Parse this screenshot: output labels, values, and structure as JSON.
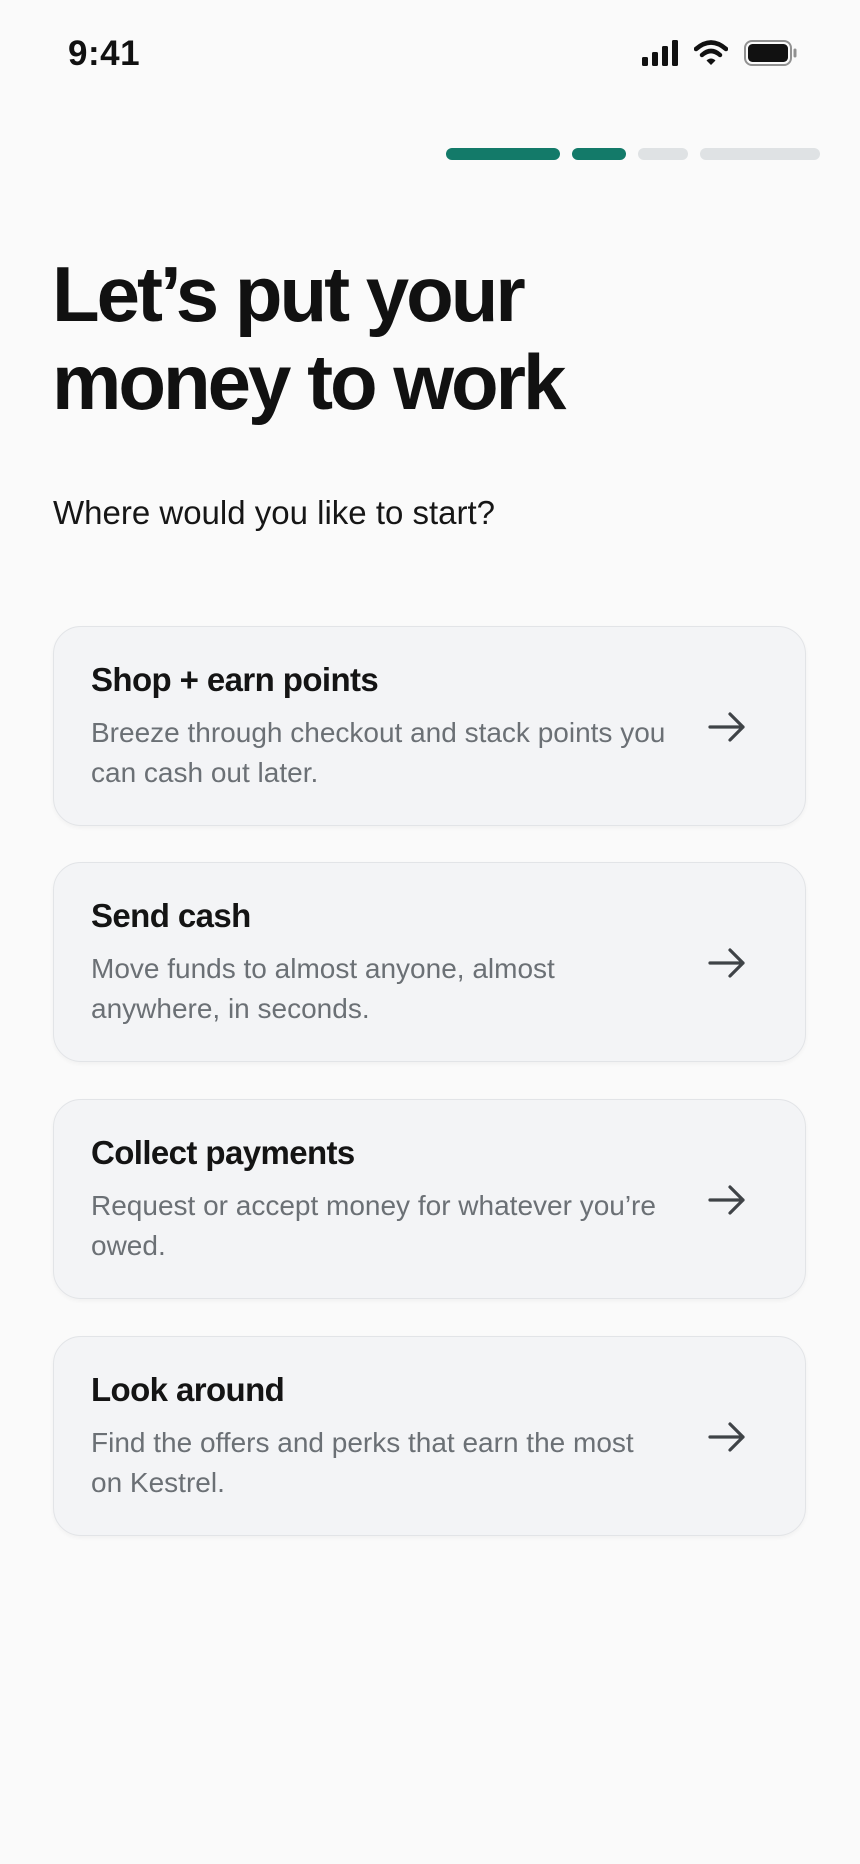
{
  "status_bar": {
    "time": "9:41",
    "icons": [
      "signal-icon",
      "wifi-icon",
      "battery-icon"
    ]
  },
  "progress": {
    "total_steps": 4,
    "completed_steps": 2,
    "active_color": "#137a69",
    "inactive_color": "#dfe2e4"
  },
  "headline": {
    "line1": "Let’s put your",
    "line2": "money to work"
  },
  "subhead": "Where would you like to start?",
  "options": [
    {
      "title": "Shop + earn points",
      "description": "Breeze through checkout and stack points you can cash out later.",
      "icon": "arrow-right-icon"
    },
    {
      "title": "Send cash",
      "description": "Move funds to almost anyone, almost anywhere, in seconds.",
      "icon": "arrow-right-icon"
    },
    {
      "title": "Collect payments",
      "description": "Request or accept money for whatever you’re owed.",
      "icon": "arrow-right-icon"
    },
    {
      "title": "Look around",
      "description": "Find the offers and perks that earn the most on Kestrel.",
      "icon": "arrow-right-icon"
    }
  ]
}
